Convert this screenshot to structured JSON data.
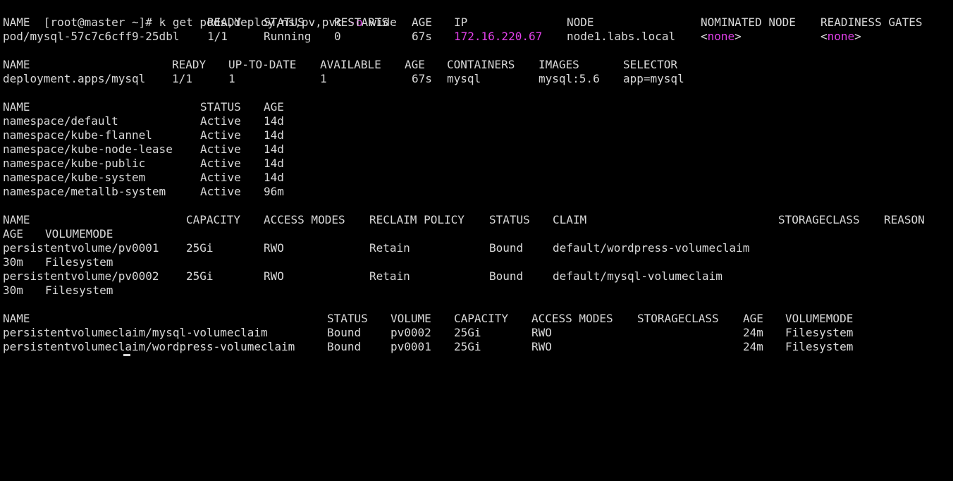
{
  "terminal": {
    "prompt": "[root@master ~]# ",
    "cmd_main": "k get pods,deploy,ns,pv,pvc ",
    "cmd_flag": "-o",
    "cmd_rest": " wide",
    "highlight_color": "#e040e8"
  },
  "pods": {
    "headers": [
      "NAME",
      "READY",
      "STATUS",
      "RESTARTS",
      "AGE",
      "IP",
      "NODE",
      "NOMINATED NODE",
      "READINESS GATES"
    ],
    "row": {
      "name": "pod/mysql-57c7c6cff9-25dbl",
      "ready": "1/1",
      "status": "Running",
      "restarts": "0",
      "age": "67s",
      "ip": "172.16.220.67",
      "node": "node1.labs.local",
      "nominated_lt": "<",
      "nominated_none": "none",
      "nominated_gt": ">",
      "gates_lt": "<",
      "gates_none": "none",
      "gates_gt": ">"
    }
  },
  "deploy": {
    "headers": [
      "NAME",
      "READY",
      "UP-TO-DATE",
      "AVAILABLE",
      "AGE",
      "CONTAINERS",
      "IMAGES",
      "SELECTOR"
    ],
    "row": [
      "deployment.apps/mysql",
      "1/1",
      "1",
      "1",
      "67s",
      "mysql",
      "mysql:5.6",
      "app=mysql"
    ]
  },
  "namespaces": {
    "headers": [
      "NAME",
      "STATUS",
      "AGE"
    ],
    "rows": [
      [
        "namespace/default",
        "Active",
        "14d"
      ],
      [
        "namespace/kube-flannel",
        "Active",
        "14d"
      ],
      [
        "namespace/kube-node-lease",
        "Active",
        "14d"
      ],
      [
        "namespace/kube-public",
        "Active",
        "14d"
      ],
      [
        "namespace/kube-system",
        "Active",
        "14d"
      ],
      [
        "namespace/metallb-system",
        "Active",
        "96m"
      ]
    ]
  },
  "pv": {
    "headers": [
      "NAME",
      "CAPACITY",
      "ACCESS MODES",
      "RECLAIM POLICY",
      "STATUS",
      "CLAIM",
      "STORAGECLASS",
      "REASON"
    ],
    "headers_wrap": [
      "AGE",
      "VOLUMEMODE"
    ],
    "rows": [
      {
        "main": [
          "persistentvolume/pv0001",
          "25Gi",
          "RWO",
          "Retain",
          "Bound",
          "default/wordpress-volumeclaim"
        ],
        "wrap": [
          "30m",
          "Filesystem"
        ]
      },
      {
        "main": [
          "persistentvolume/pv0002",
          "25Gi",
          "RWO",
          "Retain",
          "Bound",
          "default/mysql-volumeclaim"
        ],
        "wrap": [
          "30m",
          "Filesystem"
        ]
      }
    ]
  },
  "pvc": {
    "headers": [
      "NAME",
      "STATUS",
      "VOLUME",
      "CAPACITY",
      "ACCESS MODES",
      "STORAGECLASS",
      "AGE",
      "VOLUMEMODE"
    ],
    "rows": [
      [
        "persistentvolumeclaim/mysql-volumeclaim",
        "Bound",
        "pv0002",
        "25Gi",
        "RWO",
        "",
        "24m",
        "Filesystem"
      ],
      [
        "persistentvolumeclaim/wordpress-volumeclaim",
        "Bound",
        "pv0001",
        "25Gi",
        "RWO",
        "",
        "24m",
        "Filesystem"
      ]
    ]
  }
}
